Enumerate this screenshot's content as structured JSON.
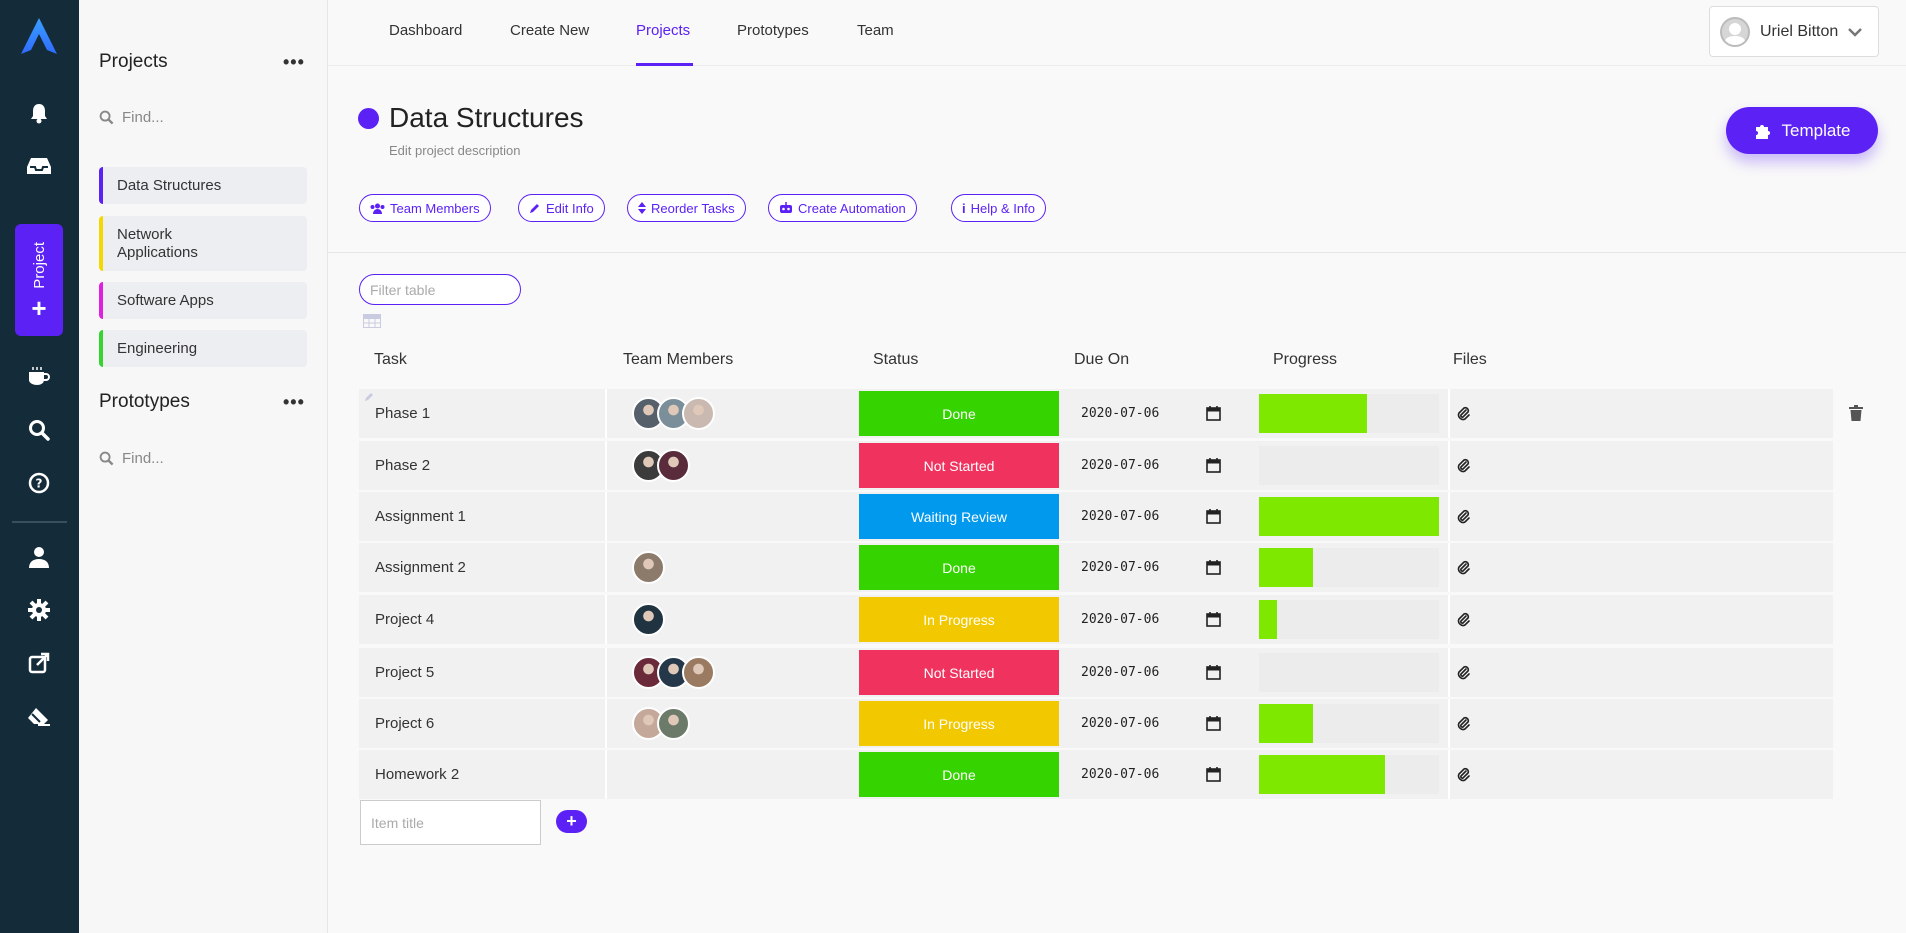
{
  "rail": {
    "project_label": "Project",
    "icons": [
      "bell-icon",
      "inbox-icon",
      "coffee-icon",
      "search-icon",
      "help-icon",
      "user-icon",
      "settings-icon",
      "external-link-icon",
      "eraser-icon"
    ]
  },
  "panel": {
    "projects_heading": "Projects",
    "projects_find": "Find...",
    "project_items": [
      {
        "label": "Data Structures",
        "color": "#5b21f5"
      },
      {
        "label": "Network Applications",
        "color": "#f5d800"
      },
      {
        "label": "Software Apps",
        "color": "#e020e0"
      },
      {
        "label": "Engineering",
        "color": "#35d42f"
      }
    ],
    "prototypes_heading": "Prototypes",
    "prototypes_find": "Find..."
  },
  "nav": {
    "tabs": [
      "Dashboard",
      "Create New",
      "Projects",
      "Prototypes",
      "Team"
    ],
    "active": "Projects",
    "user": "Uriel Bitton"
  },
  "project": {
    "title": "Data Structures",
    "description": "Edit project description",
    "template_button": "Template",
    "actions": [
      "Team Members",
      "Edit Info",
      "Reorder Tasks",
      "Create Automation",
      "Help & Info"
    ]
  },
  "table": {
    "filter_placeholder": "Filter table",
    "headers": [
      "Task",
      "Team Members",
      "Status",
      "Due On",
      "Progress",
      "Files"
    ],
    "rows": [
      {
        "task": "Phase 1",
        "members": 3,
        "status": "Done",
        "status_color": "#35d400",
        "due": "2020-07-06",
        "progress": 0.6
      },
      {
        "task": "Phase 2",
        "members": 2,
        "status": "Not Started",
        "status_color": "#f0325e",
        "due": "2020-07-06",
        "progress": 0
      },
      {
        "task": "Assignment 1",
        "members": 0,
        "status": "Waiting Review",
        "status_color": "#0099ee",
        "due": "2020-07-06",
        "progress": 1.0
      },
      {
        "task": "Assignment 2",
        "members": 1,
        "status": "Done",
        "status_color": "#35d400",
        "due": "2020-07-06",
        "progress": 0.3
      },
      {
        "task": "Project 4",
        "members": 1,
        "status": "In Progress",
        "status_color": "#f2c800",
        "due": "2020-07-06",
        "progress": 0.1
      },
      {
        "task": "Project 5",
        "members": 3,
        "status": "Not Started",
        "status_color": "#f0325e",
        "due": "2020-07-06",
        "progress": 0
      },
      {
        "task": "Project 6",
        "members": 2,
        "status": "In Progress",
        "status_color": "#f2c800",
        "due": "2020-07-06",
        "progress": 0.3
      },
      {
        "task": "Homework 2",
        "members": 0,
        "status": "Done",
        "status_color": "#35d400",
        "due": "2020-07-06",
        "progress": 0.7
      }
    ],
    "item_title_placeholder": "Item title"
  }
}
